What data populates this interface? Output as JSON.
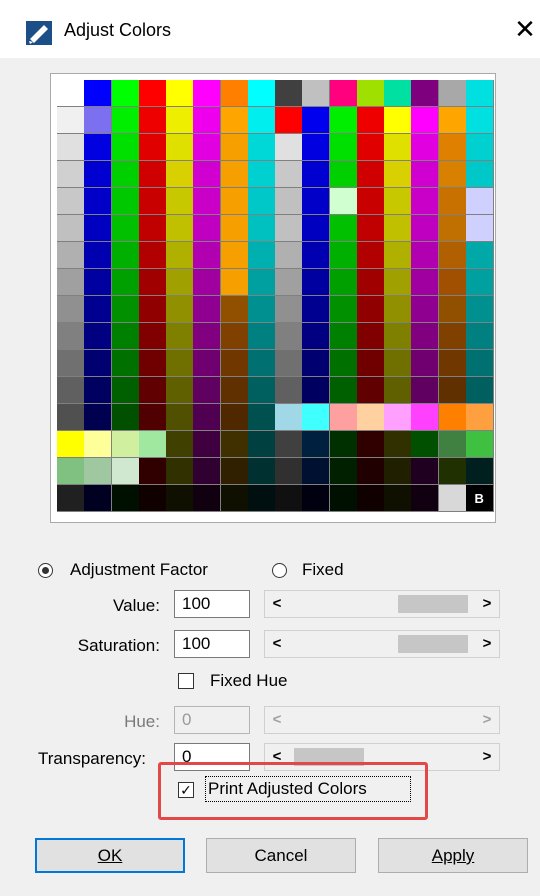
{
  "window": {
    "title": "Adjust Colors",
    "icon": "adjust-colors-app-icon",
    "close_symbol": "✕"
  },
  "palette": {
    "cols": 16,
    "rows": 16,
    "last_cell_label": "B",
    "colors": [
      [
        "#ffffff",
        "#0000ff",
        "#00ff00",
        "#ff0000",
        "#ffff00",
        "#ff00ff",
        "#ff7f00",
        "#00ffff",
        "#404040",
        "#c0c0c0",
        "#ff007f",
        "#a0e000",
        "#00e0a0",
        "#7f007f",
        "#a8a8a8",
        "#00e0e0"
      ],
      [
        "#f0f0f0",
        "#7d70f0",
        "#00ee00",
        "#ee0000",
        "#eeee00",
        "#ee00ee",
        "#ffa500",
        "#00eeee",
        "#ff0000",
        "#0000ee",
        "#00ee00",
        "#ee0000",
        "#ffff00",
        "#ff00ff",
        "#ffa500",
        "#00e0e0"
      ],
      [
        "#e0e0e0",
        "#0000e0",
        "#00e000",
        "#e00000",
        "#e0e000",
        "#e000e0",
        "#f5a000",
        "#00d8d8",
        "#e0e0e0",
        "#0000e0",
        "#00e000",
        "#e00000",
        "#e0e000",
        "#e000e0",
        "#e08000",
        "#00d0d0"
      ],
      [
        "#d0d0d0",
        "#0000d0",
        "#00d000",
        "#d00000",
        "#d8d000",
        "#d000d0",
        "#f5a000",
        "#00d0d0",
        "#c8c8c8",
        "#0000d0",
        "#00d000",
        "#d00000",
        "#d8d000",
        "#d000d0",
        "#d88000",
        "#00c8c8"
      ],
      [
        "#c8c8c8",
        "#0000c8",
        "#00c800",
        "#c80000",
        "#c8c800",
        "#c800c8",
        "#f5a000",
        "#00c8c8",
        "#c0c0c0",
        "#0000c8",
        "#d0ffd0",
        "#c80000",
        "#c8c800",
        "#c800c8",
        "#c87000",
        "#d0d0ff"
      ],
      [
        "#c0c0c0",
        "#0000c0",
        "#00c000",
        "#c00000",
        "#c0c000",
        "#c000c0",
        "#f5a000",
        "#00c0c0",
        "#c0c0c0",
        "#0000c0",
        "#00c000",
        "#c00000",
        "#c0c000",
        "#c000c0",
        "#c07000",
        "#d0d0ff"
      ],
      [
        "#b0b0b0",
        "#0000b0",
        "#00b000",
        "#b00000",
        "#b0b000",
        "#b000b0",
        "#f5a000",
        "#00b0b0",
        "#b0b0b0",
        "#0000b0",
        "#00b000",
        "#b00000",
        "#b0b000",
        "#b000b0",
        "#b06000",
        "#00a8a8"
      ],
      [
        "#a0a0a0",
        "#0000a0",
        "#00a000",
        "#a00000",
        "#a0a000",
        "#a000a0",
        "#f5a000",
        "#00a0a0",
        "#a0a0a0",
        "#0000a0",
        "#00a000",
        "#a00000",
        "#a0a000",
        "#a000a0",
        "#a05000",
        "#00a0a0"
      ],
      [
        "#909090",
        "#000090",
        "#009000",
        "#900000",
        "#909000",
        "#900090",
        "#905000",
        "#009090",
        "#909090",
        "#000090",
        "#009000",
        "#900000",
        "#909000",
        "#900090",
        "#905000",
        "#009090"
      ],
      [
        "#808080",
        "#000080",
        "#008000",
        "#800000",
        "#808000",
        "#800080",
        "#804000",
        "#008080",
        "#808080",
        "#000080",
        "#008000",
        "#800000",
        "#808000",
        "#800080",
        "#804000",
        "#008080"
      ],
      [
        "#707070",
        "#000070",
        "#007000",
        "#700000",
        "#707000",
        "#700070",
        "#703800",
        "#007070",
        "#707070",
        "#000070",
        "#007000",
        "#700000",
        "#707000",
        "#700070",
        "#703800",
        "#007070"
      ],
      [
        "#606060",
        "#000060",
        "#006000",
        "#600000",
        "#606000",
        "#600060",
        "#603000",
        "#006060",
        "#606060",
        "#000060",
        "#006000",
        "#600000",
        "#606000",
        "#600060",
        "#603000",
        "#006060"
      ],
      [
        "#505050",
        "#000050",
        "#005000",
        "#500000",
        "#505000",
        "#500050",
        "#502800",
        "#005050",
        "#a0d8e8",
        "#40ffff",
        "#ffa0a0",
        "#ffd0a0",
        "#ffa0ff",
        "#ff40ff",
        "#ff8000",
        "#ffa040"
      ],
      [
        "#ffff00",
        "#ffff99",
        "#d0f0a0",
        "#a0e8a0",
        "#404000",
        "#400040",
        "#403000",
        "#004040",
        "#404040",
        "#002040",
        "#003000",
        "#300000",
        "#303000",
        "#005000",
        "#408040",
        "#40c040"
      ],
      [
        "#80c080",
        "#a0c8a0",
        "#d0e8d0",
        "#300000",
        "#303000",
        "#300030",
        "#302000",
        "#003030",
        "#303030",
        "#001030",
        "#002000",
        "#200000",
        "#202000",
        "#200020",
        "#203000",
        "#002020"
      ],
      [
        "#202020",
        "#000020",
        "#001000",
        "#100000",
        "#101000",
        "#100010",
        "#101000",
        "#001010",
        "#101010",
        "#000010",
        "#001000",
        "#100000",
        "#101000",
        "#100010",
        "#d8d8d8",
        "#000000"
      ]
    ]
  },
  "options": {
    "adjustment_factor_label": "Adjustment Factor",
    "fixed_label": "Fixed",
    "mode": "adjustment_factor"
  },
  "fields": {
    "value": {
      "label": "Value:",
      "value": "100",
      "thumb_fraction": 0.92
    },
    "saturation": {
      "label": "Saturation:",
      "value": "100",
      "thumb_fraction": 0.92
    },
    "fixed_hue": {
      "label": "Fixed Hue",
      "checked": false
    },
    "hue": {
      "label": "Hue:",
      "value": "0",
      "enabled": false
    },
    "transparency": {
      "label": "Transparency:",
      "value": "0",
      "thumb_fraction": 0.04
    },
    "print_adjusted": {
      "label": "Print Adjusted Colors",
      "checked": true,
      "check_symbol": "✓"
    }
  },
  "scroll_arrows": {
    "left": "<",
    "right": ">"
  },
  "buttons": {
    "ok": "OK",
    "cancel": "Cancel",
    "apply": "Apply"
  }
}
